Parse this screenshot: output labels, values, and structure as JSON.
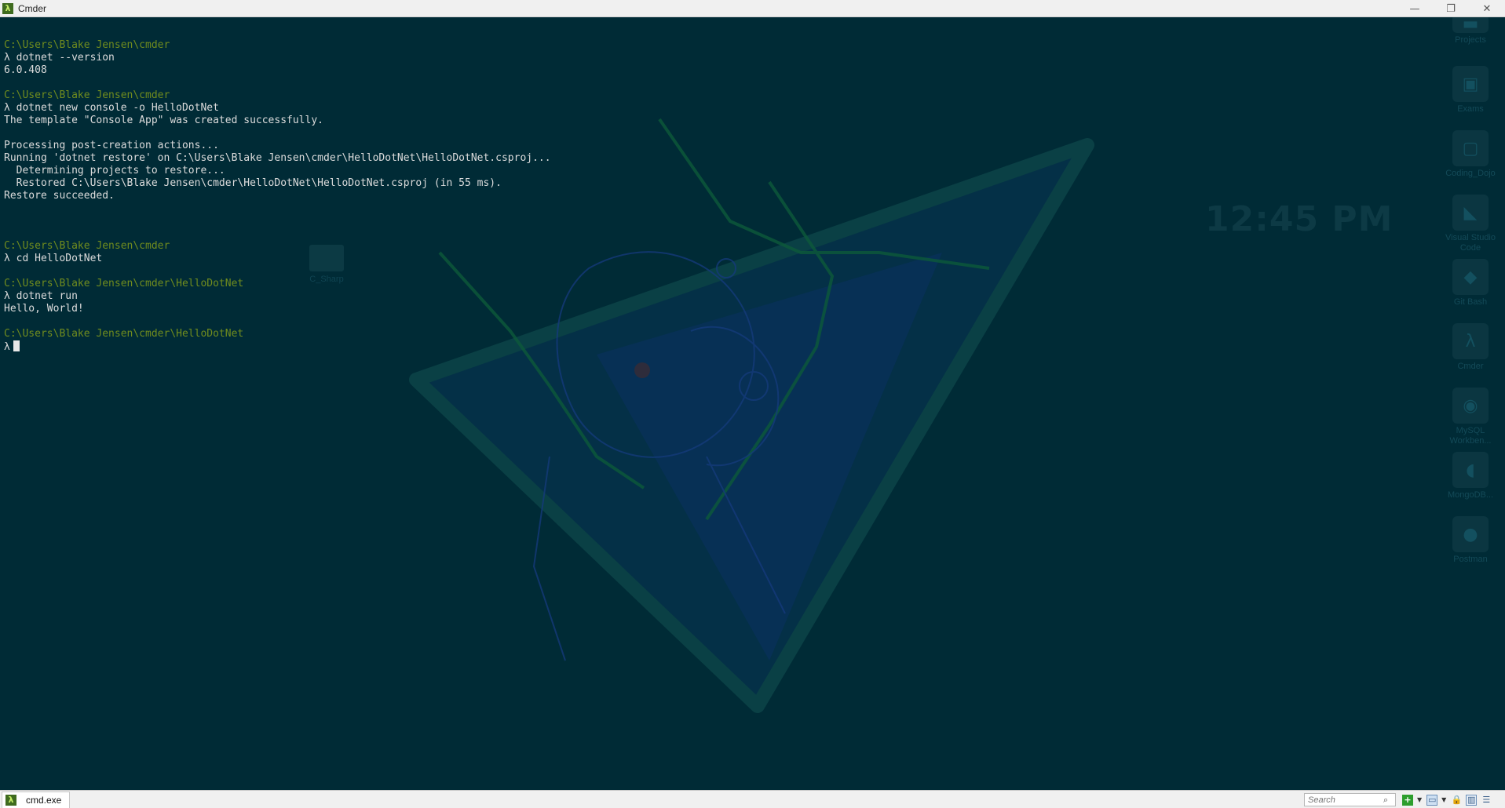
{
  "window": {
    "title": "Cmder",
    "app_icon": "lambda-icon",
    "buttons": [
      "minimize-icon",
      "restore-icon",
      "close-icon"
    ]
  },
  "console": {
    "lines": [
      {
        "type": "path",
        "text": "C:\\Users\\Blake Jensen\\cmder"
      },
      {
        "type": "cmd",
        "text": "λ dotnet --version"
      },
      {
        "type": "out",
        "text": "6.0.408"
      },
      {
        "type": "blank",
        "text": ""
      },
      {
        "type": "path",
        "text": "C:\\Users\\Blake Jensen\\cmder"
      },
      {
        "type": "cmd",
        "text": "λ dotnet new console -o HelloDotNet"
      },
      {
        "type": "out",
        "text": "The template \"Console App\" was created successfully."
      },
      {
        "type": "blank",
        "text": ""
      },
      {
        "type": "out",
        "text": "Processing post-creation actions..."
      },
      {
        "type": "out",
        "text": "Running 'dotnet restore' on C:\\Users\\Blake Jensen\\cmder\\HelloDotNet\\HelloDotNet.csproj..."
      },
      {
        "type": "out",
        "text": "  Determining projects to restore..."
      },
      {
        "type": "out",
        "text": "  Restored C:\\Users\\Blake Jensen\\cmder\\HelloDotNet\\HelloDotNet.csproj (in 55 ms)."
      },
      {
        "type": "out",
        "text": "Restore succeeded."
      },
      {
        "type": "blank",
        "text": ""
      },
      {
        "type": "blank",
        "text": ""
      },
      {
        "type": "blank",
        "text": ""
      },
      {
        "type": "path",
        "text": "C:\\Users\\Blake Jensen\\cmder"
      },
      {
        "type": "cmd",
        "text": "λ cd HelloDotNet"
      },
      {
        "type": "blank",
        "text": ""
      },
      {
        "type": "path",
        "text": "C:\\Users\\Blake Jensen\\cmder\\HelloDotNet"
      },
      {
        "type": "cmd",
        "text": "λ dotnet run"
      },
      {
        "type": "out",
        "text": "Hello, World!"
      },
      {
        "type": "blank",
        "text": ""
      },
      {
        "type": "path",
        "text": "C:\\Users\\Blake Jensen\\cmder\\HelloDotNet"
      },
      {
        "type": "prompt",
        "text": "λ"
      }
    ]
  },
  "desktop": {
    "clock": "12:45 PM",
    "folder_label": "C_Sharp",
    "icons": [
      {
        "label": "Projects",
        "icon": "folder-icon"
      },
      {
        "label": "Exams",
        "icon": "image-icon"
      },
      {
        "label": "Coding_Dojo",
        "icon": "monitor-icon"
      },
      {
        "label": "Visual Studio Code",
        "icon": "vscode-icon"
      },
      {
        "label": "Git Bash",
        "icon": "git-icon"
      },
      {
        "label": "Cmder",
        "icon": "lambda-icon"
      },
      {
        "label": "MySQL Workben...",
        "icon": "mysql-icon"
      },
      {
        "label": "MongoDB...",
        "icon": "mongodb-icon"
      },
      {
        "label": "Postman",
        "icon": "postman-icon"
      }
    ]
  },
  "statusbar": {
    "tab_label": "cmd.exe",
    "search_placeholder": "Search",
    "tools": [
      "add-console-icon",
      "view-icon",
      "lock-icon",
      "split-view-icon",
      "menu-icon"
    ]
  },
  "colors": {
    "background": "#002b36",
    "prompt_path": "#708c1e",
    "text": "#dcdcdc"
  }
}
